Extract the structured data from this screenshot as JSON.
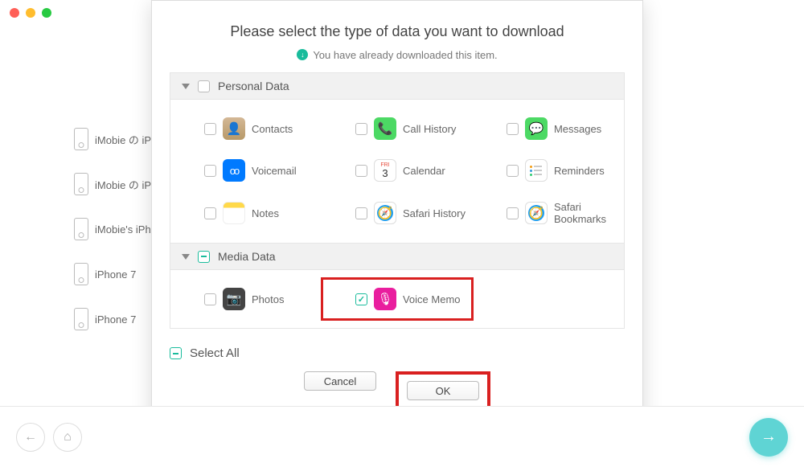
{
  "window_controls": {
    "close": "close",
    "minimize": "minimize",
    "maximize": "maximize"
  },
  "sidebar": {
    "devices": [
      {
        "label": "iMobie の iP"
      },
      {
        "label": "iMobie の iP"
      },
      {
        "label": "iMobie's iPh"
      },
      {
        "label": "iPhone 7"
      },
      {
        "label": "iPhone 7"
      }
    ]
  },
  "modal": {
    "title": "Please select the type of data you want to download",
    "subtitle": "You have already downloaded this item.",
    "groups": [
      {
        "name": "Personal Data",
        "items": [
          {
            "label": "Contacts",
            "checked": false,
            "icon": "contacts"
          },
          {
            "label": "Call History",
            "checked": false,
            "icon": "call"
          },
          {
            "label": "Messages",
            "checked": false,
            "icon": "messages"
          },
          {
            "label": "Voicemail",
            "checked": false,
            "icon": "voicemail"
          },
          {
            "label": "Calendar",
            "checked": false,
            "icon": "calendar"
          },
          {
            "label": "Reminders",
            "checked": false,
            "icon": "reminders"
          },
          {
            "label": "Notes",
            "checked": false,
            "icon": "notes"
          },
          {
            "label": "Safari History",
            "checked": false,
            "icon": "safari-h"
          },
          {
            "label": "Safari Bookmarks",
            "checked": false,
            "icon": "safari-b"
          }
        ]
      },
      {
        "name": "Media Data",
        "items": [
          {
            "label": "Photos",
            "checked": false,
            "icon": "photos"
          },
          {
            "label": "Voice Memo",
            "checked": true,
            "icon": "voicememo",
            "highlighted": true
          }
        ]
      }
    ],
    "select_all_label": "Select All",
    "select_all_state": "partial",
    "buttons": {
      "cancel": "Cancel",
      "ok": "OK"
    }
  },
  "bottom": {
    "back": "back",
    "home": "home",
    "proceed": "proceed"
  }
}
